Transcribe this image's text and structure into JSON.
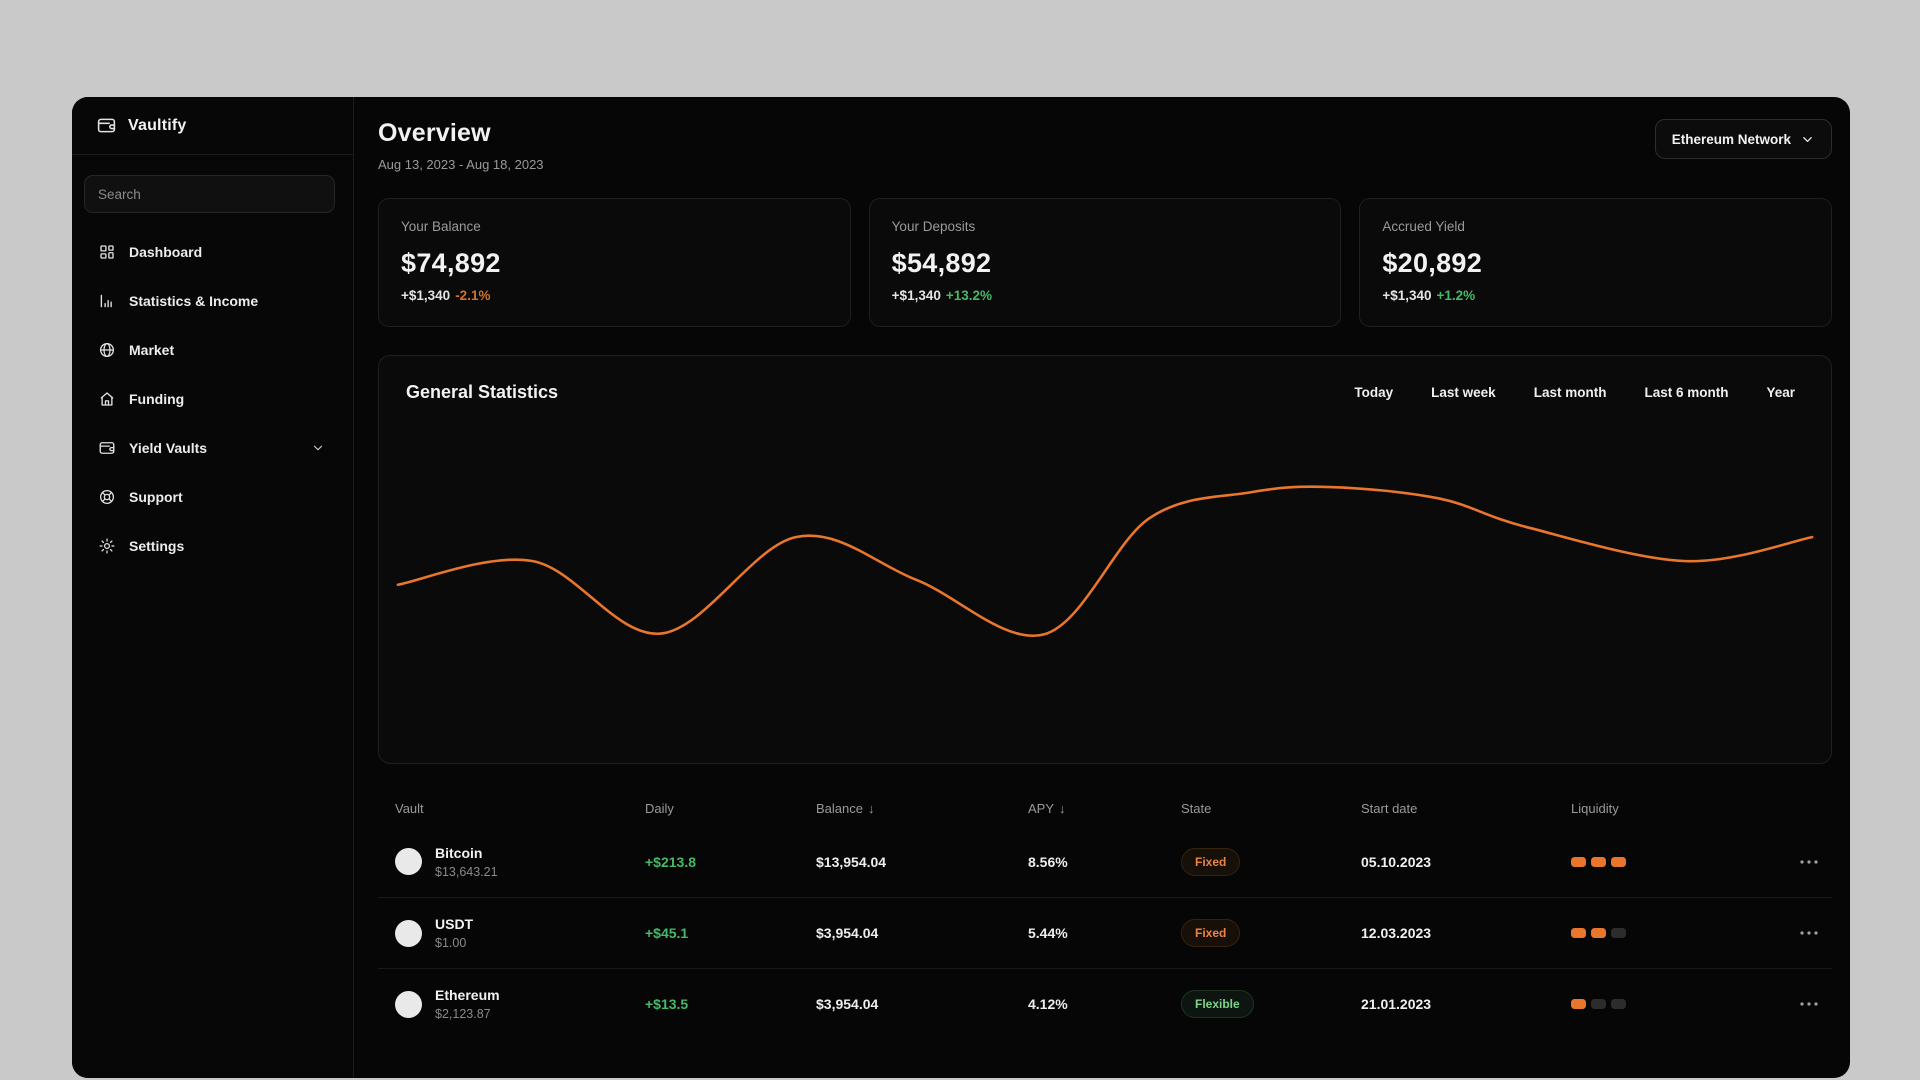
{
  "app": {
    "name": "Vaultify"
  },
  "sidebar": {
    "search_placeholder": "Search",
    "items": [
      {
        "label": "Dashboard",
        "icon": "dashboard-icon"
      },
      {
        "label": "Statistics & Income",
        "icon": "bar-chart-icon"
      },
      {
        "label": "Market",
        "icon": "globe-icon"
      },
      {
        "label": "Funding",
        "icon": "home-icon"
      },
      {
        "label": "Yield Vaults",
        "icon": "wallet-icon",
        "has_chevron": true
      },
      {
        "label": "Support",
        "icon": "lifebuoy-icon"
      },
      {
        "label": "Settings",
        "icon": "gear-icon"
      }
    ]
  },
  "header": {
    "title": "Overview",
    "date_range": "Aug 13, 2023 - Aug 18, 2023",
    "network_selector": "Ethereum Network"
  },
  "stat_cards": [
    {
      "label": "Your Balance",
      "value": "$74,892",
      "change_amount": "+$1,340",
      "change_percent": "-2.1%",
      "change_direction": "down"
    },
    {
      "label": "Your Deposits",
      "value": "$54,892",
      "change_amount": "+$1,340",
      "change_percent": "+13.2%",
      "change_direction": "up"
    },
    {
      "label": "Accrued Yield",
      "value": "$20,892",
      "change_amount": "+$1,340",
      "change_percent": "+1.2%",
      "change_direction": "up"
    }
  ],
  "statistics_panel": {
    "title": "General Statistics",
    "filters": [
      "Today",
      "Last week",
      "Last month",
      "Last 6 month",
      "Year"
    ],
    "line_color": "#e8762c"
  },
  "chart_data": {
    "type": "line",
    "title": "General Statistics",
    "axes_visible": false,
    "grid": false,
    "legend": "none",
    "series": [
      {
        "name": "portfolio-performance",
        "points_normalized": [
          [
            0.013,
            0.438
          ],
          [
            0.106,
            0.496
          ],
          [
            0.194,
            0.318
          ],
          [
            0.287,
            0.555
          ],
          [
            0.37,
            0.45
          ],
          [
            0.458,
            0.316
          ],
          [
            0.53,
            0.6
          ],
          [
            0.6,
            0.665
          ],
          [
            0.655,
            0.678
          ],
          [
            0.73,
            0.65
          ],
          [
            0.79,
            0.58
          ],
          [
            0.9,
            0.496
          ],
          [
            0.987,
            0.555
          ]
        ]
      }
    ]
  },
  "table": {
    "columns": [
      {
        "label": "Vault",
        "sort_icon": ""
      },
      {
        "label": "Daily",
        "sort_icon": ""
      },
      {
        "label": "Balance",
        "sort_icon": "↓"
      },
      {
        "label": "APY",
        "sort_icon": "↓"
      },
      {
        "label": "State",
        "sort_icon": ""
      },
      {
        "label": "Start date",
        "sort_icon": ""
      },
      {
        "label": "Liquidity",
        "sort_icon": ""
      }
    ],
    "rows": [
      {
        "vault": "Bitcoin",
        "price": "$13,643.21",
        "daily": "+$213.8",
        "balance": "$13,954.04",
        "apy": "8.56%",
        "state": "Fixed",
        "state_type": "fixed",
        "start_date": "05.10.2023",
        "liquidity": 3
      },
      {
        "vault": "USDT",
        "price": "$1.00",
        "daily": "+$45.1",
        "balance": "$3,954.04",
        "apy": "5.44%",
        "state": "Fixed",
        "state_type": "fixed",
        "start_date": "12.03.2023",
        "liquidity": 2
      },
      {
        "vault": "Ethereum",
        "price": "$2,123.87",
        "daily": "+$13.5",
        "balance": "$3,954.04",
        "apy": "4.12%",
        "state": "Flexible",
        "state_type": "flexible",
        "start_date": "21.01.2023",
        "liquidity": 1
      }
    ]
  },
  "colors": {
    "accent_orange": "#e8762c",
    "positive_green": "#46b868",
    "negative_orange": "#d0722f",
    "badge_fixed": "#ec8445",
    "badge_flexible": "#7ed48a",
    "background_outer": "#c9c9c9",
    "background_app": "#060606"
  }
}
